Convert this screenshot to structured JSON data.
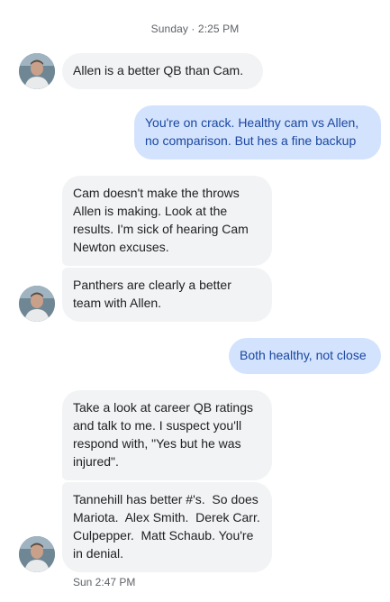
{
  "conversation": {
    "day_label": "Sunday · 2:25 PM",
    "messages": [
      {
        "from": "them",
        "text": "Allen is a better QB than Cam."
      },
      {
        "from": "me",
        "text": "You're on crack. Healthy cam vs Allen, no comparison. But hes a fine backup"
      },
      {
        "from": "them",
        "text": "Cam doesn't make the throws Allen is making. Look at the results. I'm sick of hearing Cam Newton excuses."
      },
      {
        "from": "them",
        "text": "Panthers are clearly a better team with Allen."
      },
      {
        "from": "me",
        "text": "Both healthy, not close"
      },
      {
        "from": "them",
        "text": "Take a look at career QB ratings and talk to me. I suspect you'll respond with, \"Yes but he was injured\"."
      },
      {
        "from": "them",
        "text": "Tannehill has better #'s.  So does Mariota.  Alex Smith.  Derek Carr. Culpepper.  Matt Schaub. You're in denial."
      }
    ],
    "last_time": "Sun 2:47 PM"
  },
  "colors": {
    "incoming_bubble": "#f1f3f4",
    "outgoing_bubble": "#d3e3fd",
    "outgoing_text": "#1a47a0"
  },
  "icons": {
    "avatar": "contact-avatar-photo"
  }
}
